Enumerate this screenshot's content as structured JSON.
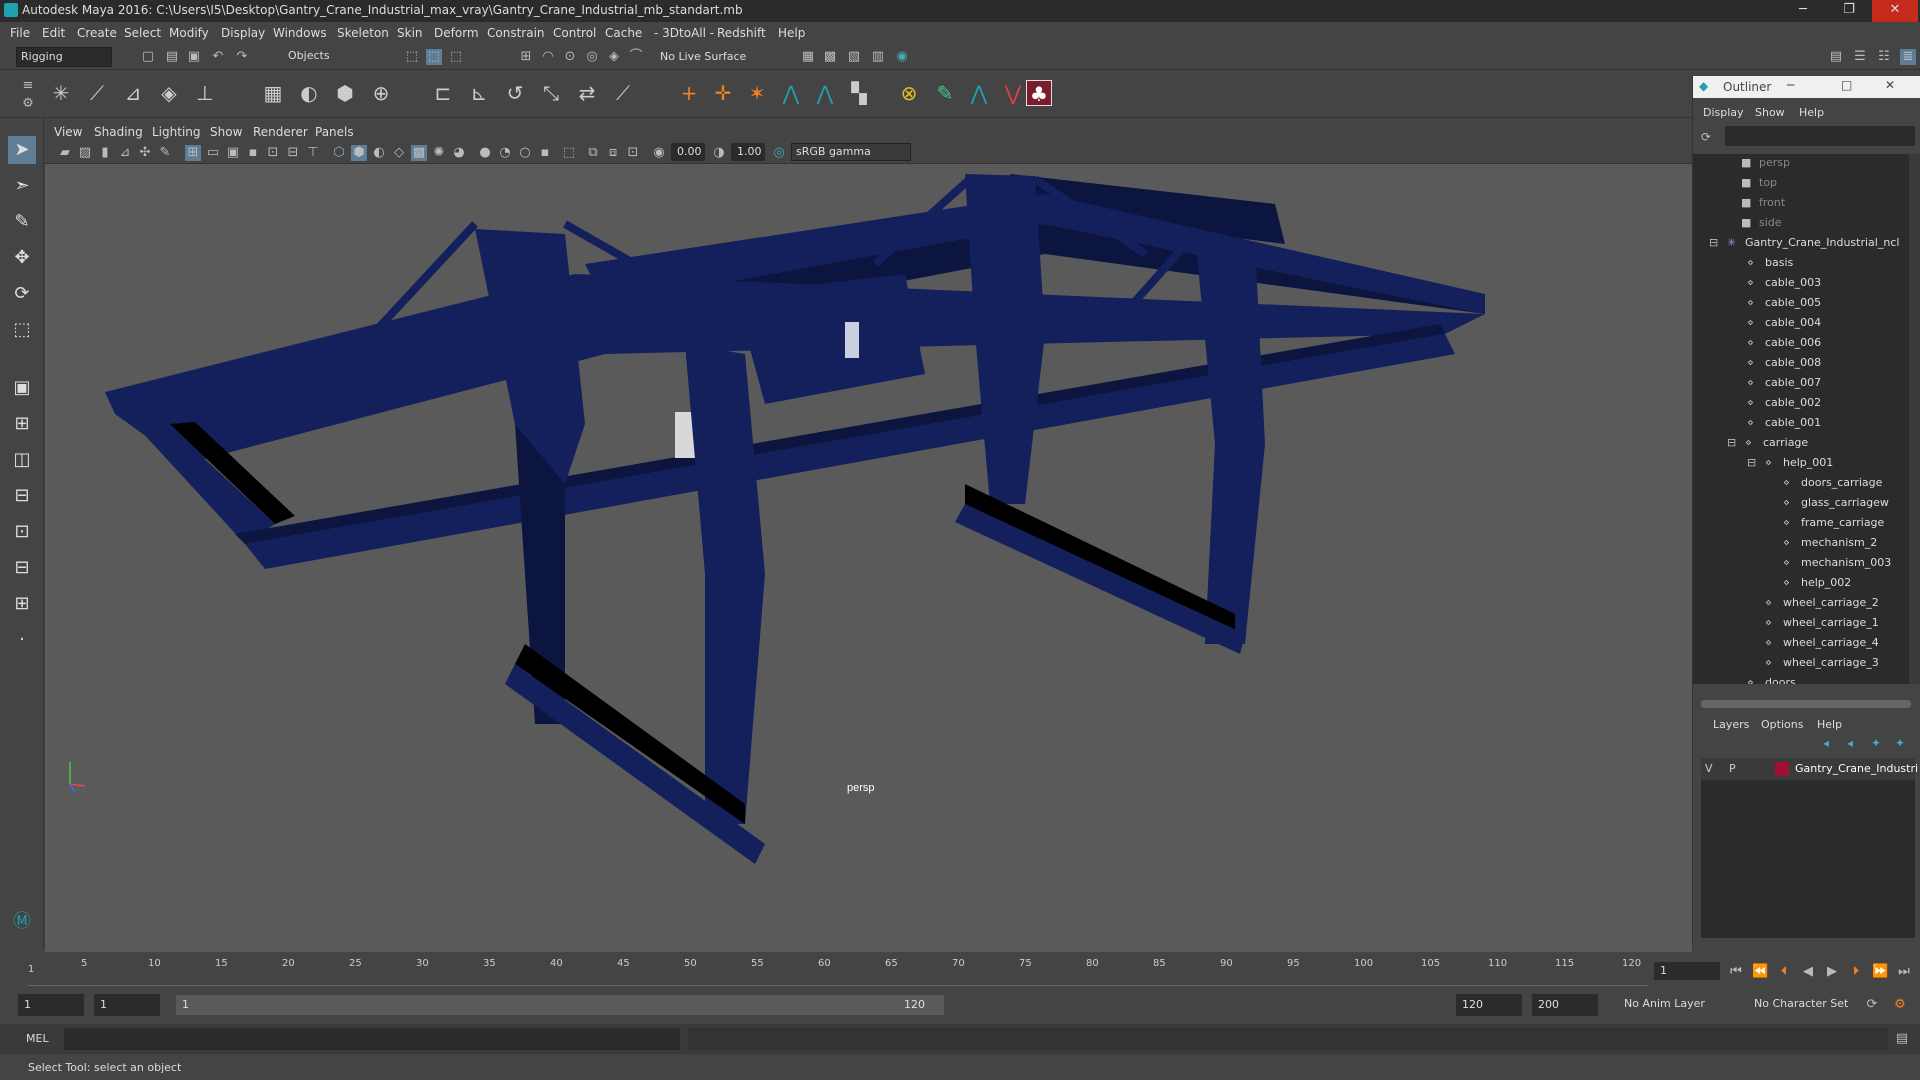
{
  "window": {
    "title": "Autodesk Maya 2016: C:\\Users\\I5\\Desktop\\Gantry_Crane_Industrial_max_vray\\Gantry_Crane_Industrial_mb_standart.mb",
    "min": "─",
    "max": "❐",
    "close": "✕"
  },
  "menu": [
    "File",
    "Edit",
    "Create",
    "Select",
    "Modify",
    "Display",
    "Windows",
    "Skeleton",
    "Skin",
    "Deform",
    "Constrain",
    "Control",
    "Cache",
    "- 3DtoAll -",
    "Redshift",
    "Help"
  ],
  "status": {
    "menuset": "Rigging",
    "selmode": "Objects",
    "live": "No Live Surface"
  },
  "viewport": {
    "menu": [
      "View",
      "Shading",
      "Lighting",
      "Show",
      "Renderer",
      "Panels"
    ],
    "exposure": "0.00",
    "gamma": "1.00",
    "colorspace": "sRGB gamma",
    "camera": "persp"
  },
  "outliner": {
    "title": "Outliner",
    "menu": [
      "Display",
      "Show",
      "Help"
    ],
    "items": [
      "persp",
      "top",
      "front",
      "side",
      "Gantry_Crane_Industrial_ncl",
      "basis",
      "cable_003",
      "cable_005",
      "cable_004",
      "cable_006",
      "cable_008",
      "cable_007",
      "cable_002",
      "cable_001",
      "carriage",
      "help_001",
      "doors_carriage",
      "glass_carriagew",
      "frame_carriage",
      "mechanism_2",
      "mechanism_003",
      "help_002",
      "wheel_carriage_2",
      "wheel_carriage_1",
      "wheel_carriage_4",
      "wheel_carriage_3",
      "doors"
    ],
    "layers_menu": [
      "Layers",
      "Options",
      "Help"
    ],
    "layer": {
      "v": "V",
      "p": "P",
      "name": "Gantry_Crane_Industri",
      "color": "#a01030"
    }
  },
  "timeline": {
    "ticks": [
      "1",
      "5",
      "10",
      "15",
      "20",
      "25",
      "30",
      "35",
      "40",
      "45",
      "50",
      "55",
      "60",
      "65",
      "70",
      "75",
      "80",
      "85",
      "90",
      "95",
      "100",
      "105",
      "110",
      "115",
      "120"
    ],
    "current": "1"
  },
  "range": {
    "start": "1",
    "start2": "1",
    "slider_start": "1",
    "slider_end": "120",
    "end": "120",
    "end2": "200",
    "anim_layer": "No Anim Layer",
    "char_set": "No Character Set"
  },
  "cmd": {
    "label": "MEL"
  },
  "help": "Select Tool: select an object",
  "colors": {
    "crane": "#13205c",
    "crane_dark": "#0c1540",
    "bg": "#5a5a5a"
  }
}
